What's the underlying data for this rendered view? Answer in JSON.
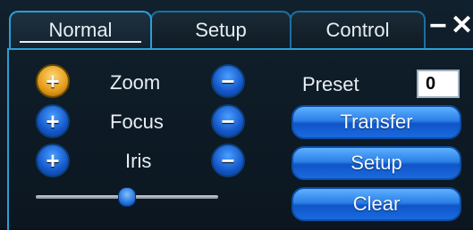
{
  "tabs": [
    {
      "label": "Normal"
    },
    {
      "label": "Setup"
    },
    {
      "label": "Control"
    }
  ],
  "window": {
    "minimize": "−",
    "close": "✕"
  },
  "controls": [
    {
      "label": "Zoom",
      "plus": "+",
      "minus": "−"
    },
    {
      "label": "Focus",
      "plus": "+",
      "minus": "−"
    },
    {
      "label": "Iris",
      "plus": "+",
      "minus": "−"
    }
  ],
  "preset": {
    "label": "Preset",
    "value": "0"
  },
  "buttons": {
    "transfer": "Transfer",
    "setup": "Setup",
    "clear": "Clear"
  },
  "slider": {
    "value": 0.5
  },
  "colors": {
    "accent": "#2a9fd6",
    "button_blue": "#1a6ae0",
    "active_plus": "#e39a1a"
  }
}
